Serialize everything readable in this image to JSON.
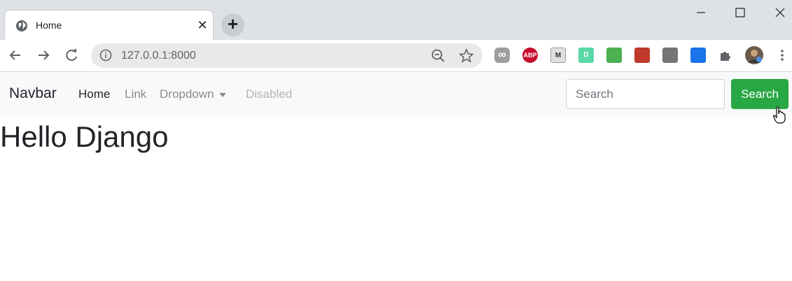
{
  "browser": {
    "tab": {
      "title": "Home",
      "close": "✕"
    },
    "new_tab": "+",
    "address": "127.0.0.1:8000",
    "window_controls": {
      "minimize": "minimize-icon",
      "maximize": "maximize-icon",
      "close": "close-icon"
    },
    "extensions": [
      {
        "name": "infinity-extension-icon",
        "label": "∞",
        "color": "#9e9e9e"
      },
      {
        "name": "adblock-plus-icon",
        "label": "ABP",
        "color": "#c70d2c"
      },
      {
        "name": "mercury-reader-icon",
        "label": "M",
        "color": "#e0e0e0"
      },
      {
        "name": "dashlane-icon",
        "label": "D",
        "color": "#5ad8a6"
      },
      {
        "name": "globe-extension-icon",
        "label": "",
        "color": "#4caf50"
      },
      {
        "name": "book-extension-icon",
        "label": "",
        "color": "#c0392b"
      },
      {
        "name": "barcode-extension-icon",
        "label": "",
        "color": "#757575"
      },
      {
        "name": "bookmark-extension-icon",
        "label": "",
        "color": "#1a73e8"
      }
    ]
  },
  "navbar": {
    "brand": "Navbar",
    "links": {
      "home": "Home",
      "link": "Link",
      "dropdown": "Dropdown",
      "disabled": "Disabled"
    },
    "search": {
      "placeholder": "Search",
      "button": "Search"
    },
    "button_color": "#28a745"
  },
  "main": {
    "heading": "Hello Django"
  }
}
